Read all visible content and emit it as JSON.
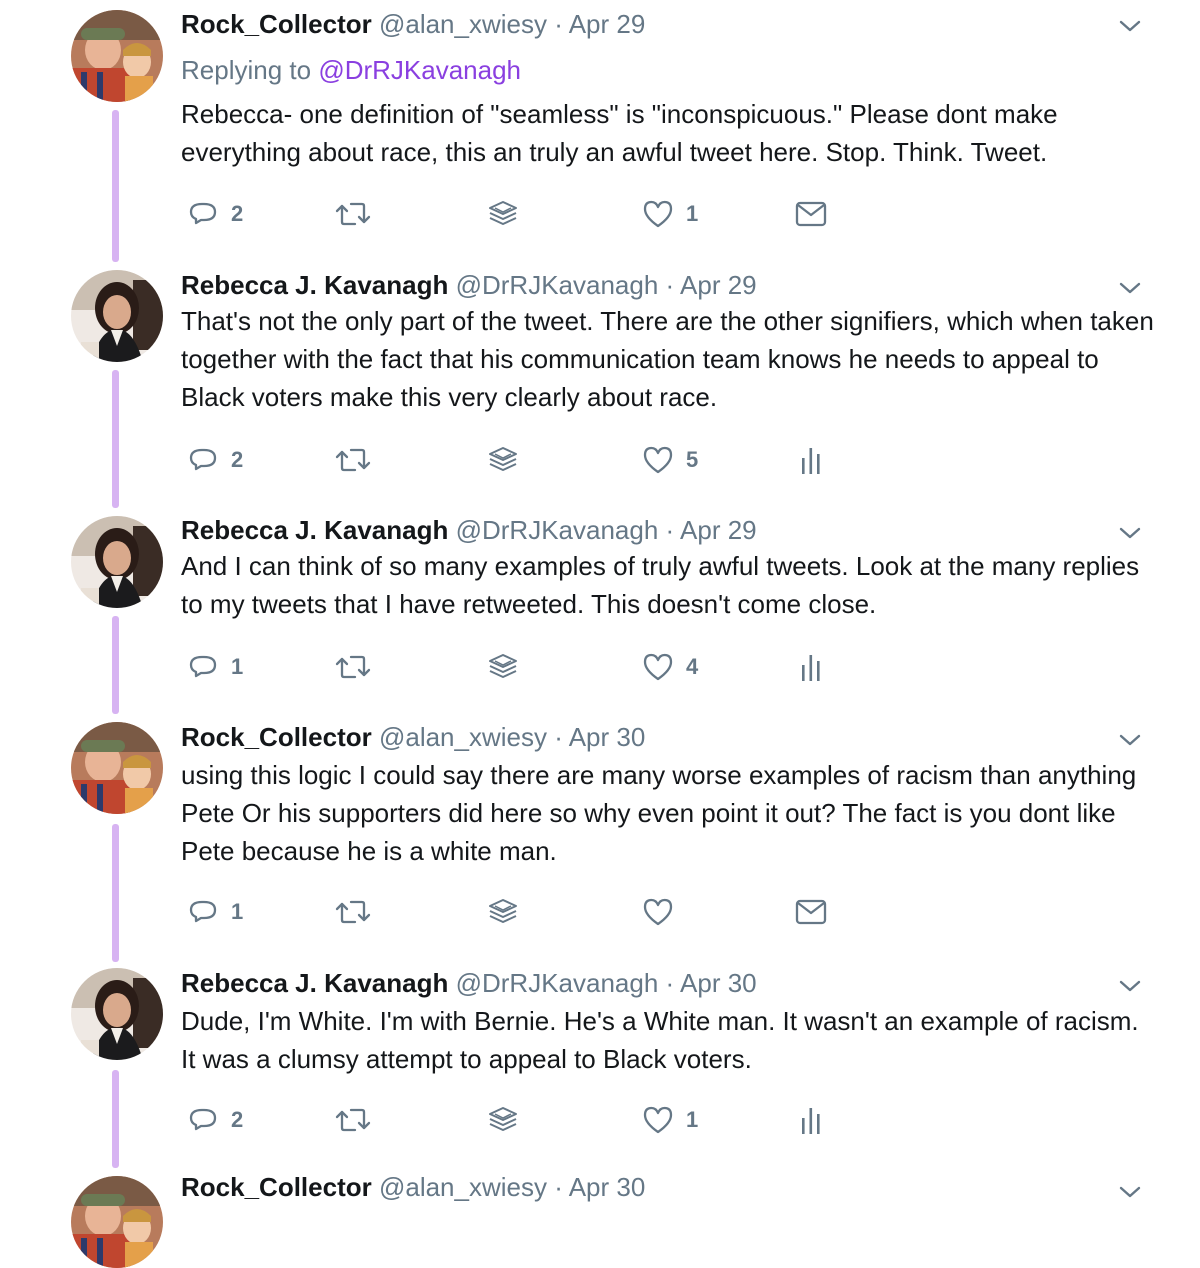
{
  "colors": {
    "thread_line": "#d7b3f2",
    "mention": "#8a3fe0",
    "muted": "#657786",
    "text": "#14171a"
  },
  "tweets": [
    {
      "name": "Rock_Collector",
      "handle": "@alan_xwiesy",
      "date": "Apr 29",
      "replying_prefix": "Replying to",
      "replying_to": "@DrRJKavanagh",
      "text": "Rebecca- one definition of \"seamless\" is \"inconspicuous.\" Please dont make everything about race, this an truly an awful tweet here. Stop. Think. Tweet.",
      "replies": "2",
      "likes": "1",
      "last_action_icon": "mail-icon"
    },
    {
      "name": "Rebecca J. Kavanagh",
      "handle": "@DrRJKavanagh",
      "date": "Apr 29",
      "text": "That's not the only part of the tweet. There are the other signifiers, which when taken together with the fact that his communication team knows he needs to appeal to Black voters make this very clearly about race.",
      "replies": "2",
      "likes": "5",
      "last_action_icon": "analytics-icon"
    },
    {
      "name": "Rebecca J. Kavanagh",
      "handle": "@DrRJKavanagh",
      "date": "Apr 29",
      "text": "And I can think of so many examples of truly awful tweets. Look at the many replies to my tweets that I have retweeted. This doesn't come close.",
      "replies": "1",
      "likes": "4",
      "last_action_icon": "analytics-icon"
    },
    {
      "name": "Rock_Collector",
      "handle": "@alan_xwiesy",
      "date": "Apr 30",
      "text": "using this logic I could say there are many worse examples of racism than anything Pete Or his supporters did here so why even point it out? The fact is you dont like Pete because he is a white man.",
      "replies": "1",
      "likes": "",
      "last_action_icon": "mail-icon"
    },
    {
      "name": "Rebecca J. Kavanagh",
      "handle": "@DrRJKavanagh",
      "date": "Apr 30",
      "text": "Dude, I'm White. I'm with Bernie. He's a White man. It wasn't an example of racism. It was a clumsy attempt to appeal to Black voters.",
      "replies": "2",
      "likes": "1",
      "last_action_icon": "analytics-icon"
    },
    {
      "name": "Rock_Collector",
      "handle": "@alan_xwiesy",
      "date": "Apr 30"
    }
  ]
}
